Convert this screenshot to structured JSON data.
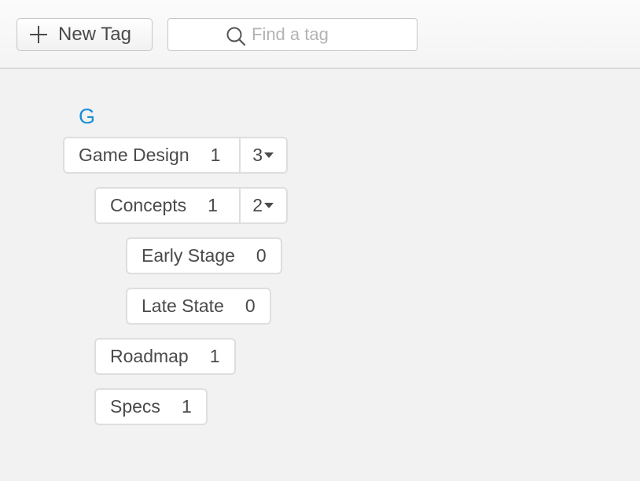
{
  "toolbar": {
    "new_tag_label": "New Tag",
    "search_placeholder": "Find a tag"
  },
  "group": {
    "letter": "G"
  },
  "tags": {
    "game_design": {
      "name": "Game Design",
      "count": "1",
      "children": "3"
    },
    "concepts": {
      "name": "Concepts",
      "count": "1",
      "children": "2"
    },
    "early_stage": {
      "name": "Early Stage",
      "count": "0"
    },
    "late_state": {
      "name": "Late State",
      "count": "0"
    },
    "roadmap": {
      "name": "Roadmap",
      "count": "1"
    },
    "specs": {
      "name": "Specs",
      "count": "1"
    }
  },
  "icons": {
    "new_tag": "plus-icon",
    "search": "search-icon",
    "expand": "caret-down-icon"
  },
  "colors": {
    "accent": "#1a8fd8",
    "background": "#f2f2f2",
    "text": "#4a4a4a",
    "placeholder": "#b3b3b3",
    "border": "#dedede"
  }
}
